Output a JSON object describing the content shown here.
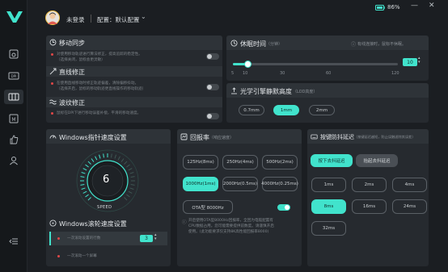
{
  "header": {
    "user": "未登录",
    "config": "配置：默认配置",
    "battery": "86%"
  },
  "sync": {
    "title": "移动同步",
    "desc1": "对使用移动轨迹进行算法修正，提高追踪的稳定性。",
    "desc2": "（选择关闭，鼠标会更灵敏）"
  },
  "straight": {
    "title": "直线修正",
    "desc1": "在使用直线移动时修正轨迹偏差，清除偏移抖动。",
    "desc2": "（选择开启，鼠标的移动轨迹更直线操作的移动轨迹）"
  },
  "ripple": {
    "title": "波纹修正",
    "desc1": "鼠标在DPI下进行移动误差补偿，平滑的移动速度。"
  },
  "sleep": {
    "title": "休眠时间",
    "unit": "（分钟）",
    "hint": "有线连接时，鼠标不休眠。",
    "value": "10",
    "value_frac": 0.09,
    "ticks": [
      "5",
      "10",
      "30",
      "60",
      "120"
    ]
  },
  "lod": {
    "title": "光学引擎静默高度",
    "sub": "（LOD高度）",
    "options": [
      "0.7mm",
      "1mm",
      "2mm"
    ],
    "selected": "1mm"
  },
  "pointer": {
    "title": "Windows指针速度设置",
    "value": "6",
    "label": "SPEED"
  },
  "scroll": {
    "title": "Windows滚轮速度设置",
    "opt1": "一次滚动设置的行数",
    "opt1_value": "3",
    "opt2": "一次滚动一个屏幕"
  },
  "rate": {
    "title": "回报率",
    "sub": "（响应速度）",
    "options": [
      "125Hz(8ms)",
      "250Hz(4ms)",
      "500Hz(2ms)",
      "1000Hz(1ms)",
      "2000Hz(0.5ms)",
      "4000Hz(0.25ms)"
    ],
    "selected": "1000Hz(1ms)",
    "ota": "OTA型 8000Hz",
    "note1": "开启使用OTA型8000Hz回报率，全回为电脑配置有",
    "note2": "CPU数据占用。您可能需要提供前数度。请谨慎开启",
    "note3": "使用。(此功能要求仅支持8K高性能回报率8000)"
  },
  "debounce": {
    "title": "按键防抖延迟",
    "sub": "（按键延迟越短，防止误触滤除其误差）",
    "tab1": "按下去抖延迟",
    "tab2": "抬起去抖延迟",
    "options": [
      "1ms",
      "2ms",
      "4ms",
      "8ms",
      "16ms",
      "24ms",
      "32ms"
    ],
    "selected": "8ms"
  },
  "colors": {
    "accent": "#41e3cc",
    "bg": "#1b1e22",
    "card": "#262a2f"
  }
}
